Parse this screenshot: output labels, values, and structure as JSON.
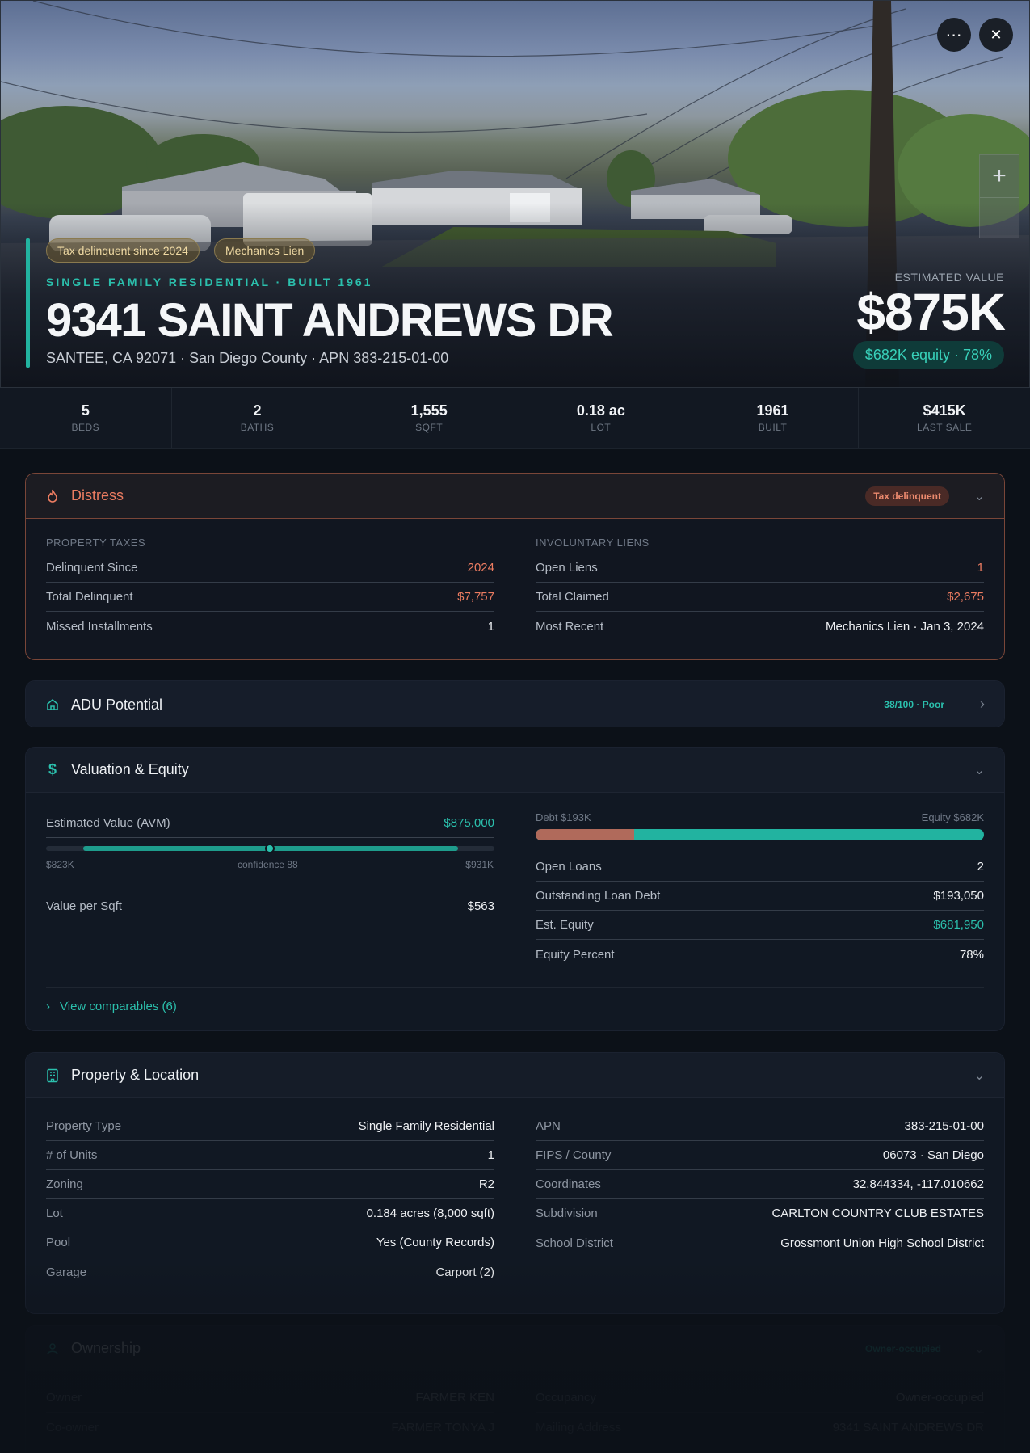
{
  "hero": {
    "tags": [
      "Tax delinquent since 2024",
      "Mechanics Lien"
    ],
    "eyebrow": "SINGLE FAMILY RESIDENTIAL · BUILT 1961",
    "address": "9341 SAINT ANDREWS DR",
    "subaddress": "SANTEE, CA 92071 · San Diego County · APN 383-215-01-00",
    "estimated_label": "ESTIMATED VALUE",
    "estimated_value": "$875K",
    "equity_pill": "$682K equity · 78%",
    "more_glyph": "⋯",
    "close_glyph": "✕",
    "zoom_glyph": "+"
  },
  "stats": [
    {
      "value": "5",
      "label": "BEDS"
    },
    {
      "value": "2",
      "label": "BATHS"
    },
    {
      "value": "1,555",
      "label": "SQFT"
    },
    {
      "value": "0.18 ac",
      "label": "LOT"
    },
    {
      "value": "1961",
      "label": "BUILT"
    },
    {
      "value": "$415K",
      "label": "LAST SALE"
    }
  ],
  "distress": {
    "title": "Distress",
    "badge": "Tax delinquent",
    "taxes": {
      "label": "PROPERTY TAXES",
      "rows": [
        {
          "k": "Delinquent Since",
          "v": "2024"
        },
        {
          "k": "Total Delinquent",
          "v": "$7,757"
        },
        {
          "k": "Missed Installments",
          "v": "1"
        }
      ]
    },
    "liens": {
      "label": "INVOLUNTARY LIENS",
      "rows": [
        {
          "k": "Open Liens",
          "v": "1"
        },
        {
          "k": "Total Claimed",
          "v": "$2,675"
        },
        {
          "k": "Most Recent",
          "v": "Mechanics Lien · Jan 3, 2024"
        }
      ]
    }
  },
  "adu": {
    "title": "ADU Potential",
    "badge": "38/100 · Poor"
  },
  "valuation": {
    "title": "Valuation & Equity",
    "avm_label": "Estimated Value (AVM)",
    "avm_value": "$875,000",
    "range_low": "$823K",
    "range_high": "$931K",
    "confidence": "confidence 88",
    "vps_label": "Value per Sqft",
    "vps_value": "$563",
    "debt_label": "Debt $193K",
    "equity_label": "Equity $682K",
    "debt_fraction": 0.22,
    "rows": [
      {
        "k": "Open Loans",
        "v": "2"
      },
      {
        "k": "Outstanding Loan Debt",
        "v": "$193,050"
      },
      {
        "k": "Est. Equity",
        "v": "$681,950"
      },
      {
        "k": "Equity Percent",
        "v": "78%"
      }
    ],
    "comparables": "View comparables (6)"
  },
  "property": {
    "title": "Property & Location",
    "left": [
      {
        "k": "Property Type",
        "v": "Single Family Residential"
      },
      {
        "k": "# of Units",
        "v": "1"
      },
      {
        "k": "Zoning",
        "v": "R2"
      },
      {
        "k": "Lot",
        "v": "0.184 acres (8,000 sqft)"
      },
      {
        "k": "Pool",
        "v": "Yes (County Records)"
      },
      {
        "k": "Garage",
        "v": "Carport (2)"
      }
    ],
    "right": [
      {
        "k": "APN",
        "v": "383-215-01-00"
      },
      {
        "k": "FIPS / County",
        "v": "06073 · San Diego"
      },
      {
        "k": "Coordinates",
        "v": "32.844334, -117.010662"
      },
      {
        "k": "Subdivision",
        "v": "CARLTON COUNTRY CLUB ESTATES"
      },
      {
        "k": "School District",
        "v": "Grossmont Union High School District"
      }
    ]
  },
  "ownership": {
    "title": "Ownership",
    "badge": "Owner-occupied",
    "left": [
      {
        "k": "Owner",
        "v": "FARMER KEN"
      },
      {
        "k": "Co-owner",
        "v": "FARMER TONYA J"
      }
    ],
    "right": [
      {
        "k": "Occupancy",
        "v": "Owner-occupied"
      },
      {
        "k": "Mailing Address",
        "v": "9341 SAINT ANDREWS DR"
      }
    ]
  },
  "colors": {
    "accent": "#2bc0ad",
    "danger": "#ec7c61",
    "tag": "#efd9a3"
  }
}
